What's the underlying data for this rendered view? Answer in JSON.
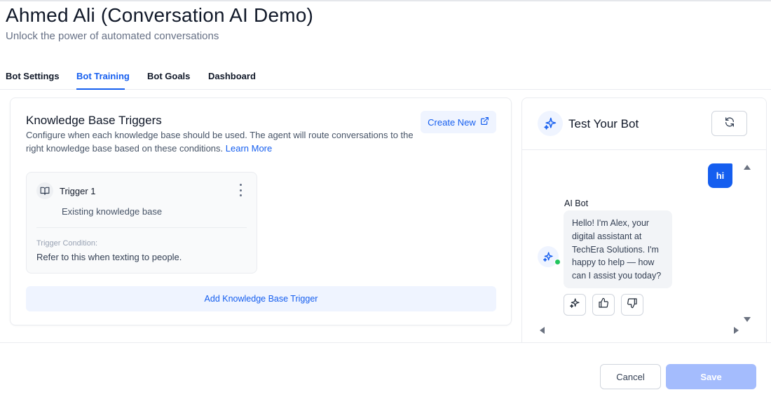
{
  "header": {
    "title": "Ahmed Ali (Conversation AI Demo)",
    "subtitle": "Unlock the power of automated conversations"
  },
  "tabs": [
    {
      "label": "Bot Settings",
      "active": false
    },
    {
      "label": "Bot Training",
      "active": true
    },
    {
      "label": "Bot Goals",
      "active": false
    },
    {
      "label": "Dashboard",
      "active": false
    }
  ],
  "knowledge_base": {
    "title": "Knowledge Base Triggers",
    "description": "Configure when each knowledge base should be used. The agent will route conversations to the right knowledge base based on these conditions.",
    "learn_more": "Learn More",
    "create_new": "Create New",
    "triggers": [
      {
        "name": "Trigger 1",
        "knowledge_base": "Existing knowledge base",
        "condition_label": "Trigger Condition:",
        "condition": "Refer to this when texting to people."
      }
    ],
    "add_trigger": "Add Knowledge Base Trigger"
  },
  "test_bot": {
    "title": "Test Your Bot",
    "messages": [
      {
        "from": "user",
        "text": "hi"
      },
      {
        "from": "bot",
        "sender": "AI Bot",
        "text": "Hello! I'm Alex, your digital assistant at TechEra Solutions. I'm happy to help — how can I assist you today?"
      }
    ],
    "actions": [
      "sparkle-icon",
      "thumbs-up-icon",
      "thumbs-down-icon"
    ]
  },
  "footer": {
    "cancel": "Cancel",
    "save": "Save"
  },
  "colors": {
    "accent": "#155eef",
    "accent_light": "#eff4ff",
    "save_disabled": "#a4bcfd",
    "online": "#22c55e"
  }
}
